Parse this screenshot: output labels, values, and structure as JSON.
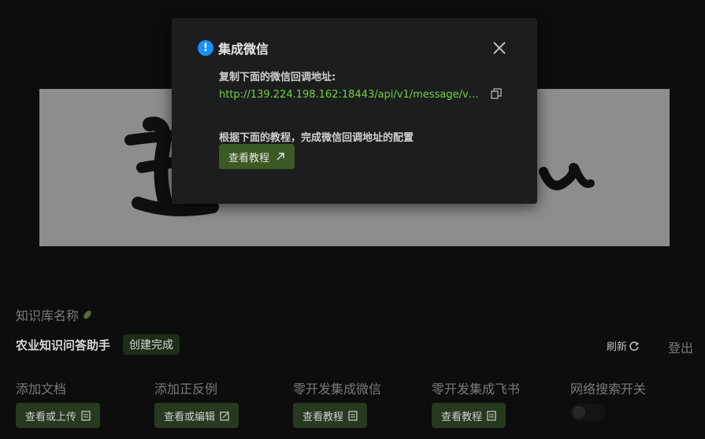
{
  "modal": {
    "title": "集成微信",
    "copy_label": "复制下面的微信回调地址:",
    "callback_url": "http://139.224.198.162:18443/api/v1/message/v1/w...",
    "tutorial_label": "根据下面的教程，完成微信回调地址的配置",
    "tutorial_button": "查看教程"
  },
  "kb": {
    "name_label": "知识库名称",
    "title": "农业知识问答助手",
    "status": "创建完成"
  },
  "header_actions": {
    "refresh": "刷新",
    "logout": "登出"
  },
  "sections": [
    {
      "label": "添加文档",
      "button": "查看或上传"
    },
    {
      "label": "添加正反例",
      "button": "查看或编辑"
    },
    {
      "label": "零开发集成微信",
      "button": "查看教程"
    },
    {
      "label": "零开发集成飞书",
      "button": "查看教程"
    },
    {
      "label": "网络搜索开关"
    }
  ],
  "colors": {
    "accent_green": "#73d13d",
    "button_green": "#27391f",
    "info_blue": "#1890ff"
  }
}
